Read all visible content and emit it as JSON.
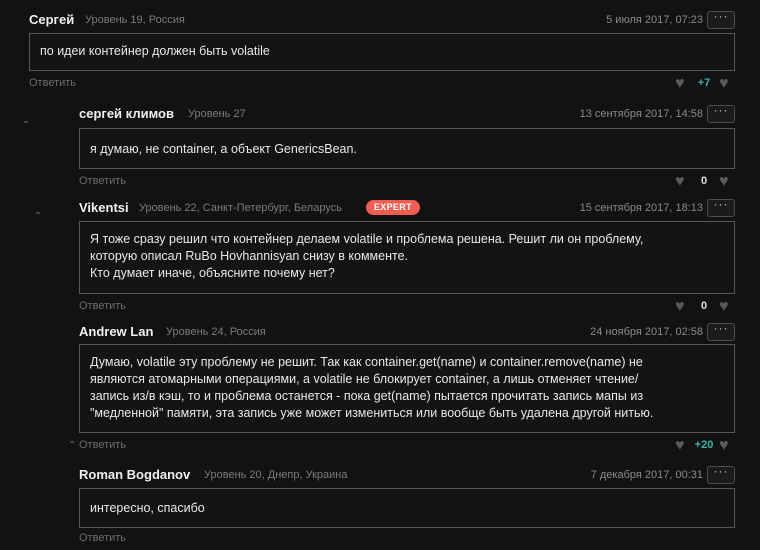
{
  "comments": [
    {
      "author": "Сергей",
      "meta": "Уровень 19, Россия",
      "date": "5 июля 2017, 07:23",
      "text": [
        "по идеи контейнер должен быть volatile"
      ],
      "reply": "Ответить",
      "score": "+7"
    },
    {
      "author": "сергей климов",
      "meta": "Уровень 27",
      "date": "13 сентября 2017, 14:58",
      "text": [
        "я думаю, не container, а объект GenericsBean."
      ],
      "reply": "Ответить",
      "score": "0"
    },
    {
      "author": "Vikentsi",
      "meta": "Уровень 22, Санкт-Петербург, Беларусь",
      "badge": "EXPERT",
      "date": "15 сентября 2017, 18:13",
      "text": [
        "Я тоже сразу решил что контейнер делаем volatile и проблема решена. Решит ли он проблему,",
        "которую описал RuBo Hovhannisyan снизу в комменте.",
        "Кто думает иначе, объясните почему нет?"
      ],
      "reply": "Ответить",
      "score": "0"
    },
    {
      "author": "Andrew Lan",
      "meta": "Уровень 24, Россия",
      "date": "24 ноября 2017, 02:58",
      "text": [
        "Думаю, volatile эту проблему не решит. Так как  container.get(name) и container.remove(name) не",
        "являются атомарными операциями, а volatile не блокирует container, а лишь отменяет чтение/",
        "запись из/в кэш, то и проблема останется - пока get(name) пытается прочитать запись мапы из",
        "\"медленной\" памяти, эта запись уже может измениться или вообще быть удалена другой нитью."
      ],
      "reply": "Ответить",
      "score": "+20"
    },
    {
      "author": "Roman Bogdanov",
      "meta": "Уровень 20, Днепр, Украина",
      "date": "7 декабря 2017, 00:31",
      "text": [
        "интересно, спасибо"
      ],
      "reply": "Ответить"
    }
  ],
  "colors": {
    "positive": "#38b6a6",
    "badge": "#ef5d52",
    "background": "#121212"
  },
  "icons": {
    "more": "more-dots-icon",
    "down": "heart-down-icon",
    "up": "heart-up-icon"
  }
}
